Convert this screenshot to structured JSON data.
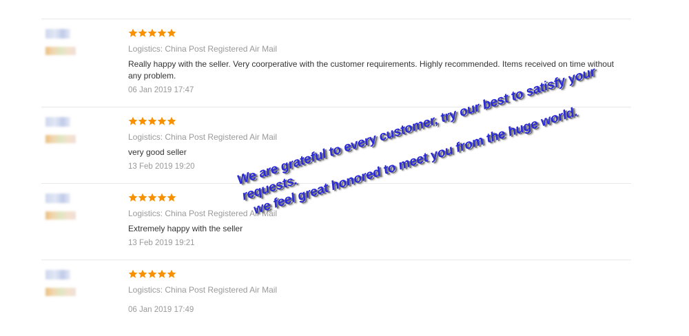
{
  "colors": {
    "star": "#f79100",
    "overlay_text": "#2a2ad9",
    "meta_text": "#999999",
    "body_text": "#333333"
  },
  "icons": {
    "rating_star": "star-icon"
  },
  "reviews": [
    {
      "rating": 5,
      "logistics": "Logistics: China Post Registered Air Mail",
      "comment": "Really happy with the seller. Very coorperative with the customer requirements. Highly recommended. Items received on time without any problem.",
      "date": "06 Jan 2019 17:47"
    },
    {
      "rating": 5,
      "logistics": "Logistics: China Post Registered Air Mail",
      "comment": "very good seller",
      "date": "13 Feb 2019 19:20"
    },
    {
      "rating": 5,
      "logistics": "Logistics: China Post Registered Air Mail",
      "comment": "Extremely happy with the seller",
      "date": "13 Feb 2019 19:21"
    },
    {
      "rating": 5,
      "logistics": "Logistics: China Post Registered Air Mail",
      "comment": "",
      "date": "06 Jan 2019 17:49"
    }
  ],
  "overlay": {
    "line1": "We are grateful to every customer, try our best to satisfy your requests.",
    "line2": "we feel great honored to meet you from the huge world."
  }
}
